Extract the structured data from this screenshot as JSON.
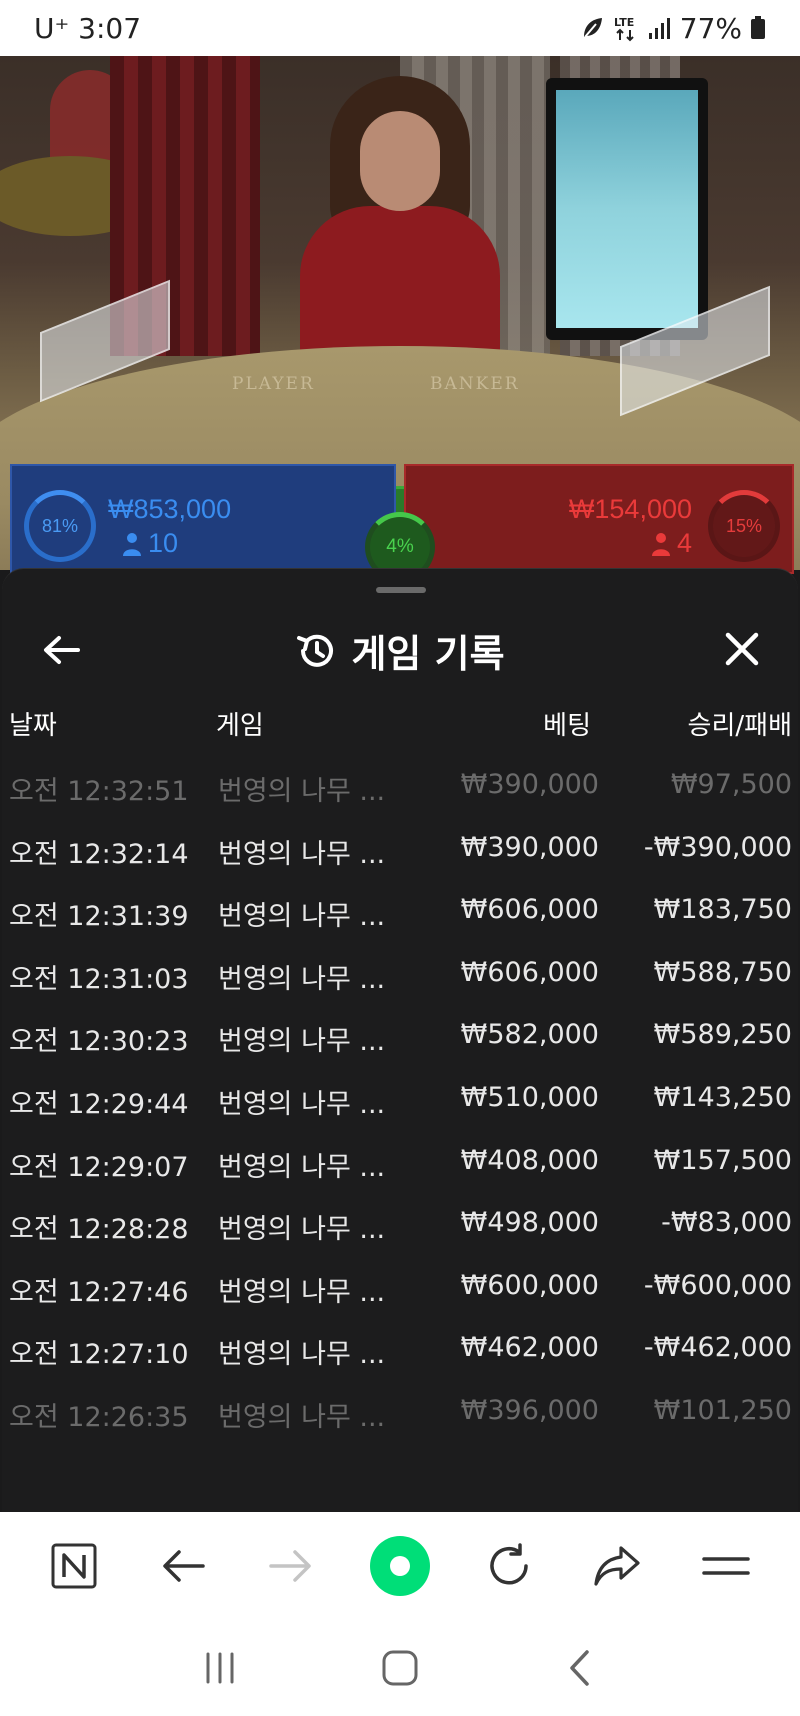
{
  "status_bar": {
    "carrier": "U⁺ 3:07",
    "network": "LTE",
    "battery": "77%"
  },
  "video": {
    "table_labels": {
      "player": "PLAYER",
      "banker": "BANKER"
    }
  },
  "bets": {
    "player": {
      "percent": "81%",
      "amount": "₩853,000",
      "count": "10",
      "color": "#3a8df0"
    },
    "tie": {
      "percent": "4%",
      "color": "#49d24e"
    },
    "banker": {
      "percent": "15%",
      "amount": "₩154,000",
      "count": "4",
      "color": "#ea3a3a"
    }
  },
  "sheet": {
    "title": "게임 기록",
    "icons": {
      "back": "arrow-left-icon",
      "history": "history-icon",
      "close": "close-icon"
    },
    "columns": {
      "date": "날짜",
      "game": "게임",
      "bet": "베팅",
      "result": "승리/패배"
    },
    "rows": [
      {
        "date": "오전 12:32:51",
        "game": "번영의 나무 ...",
        "bet": "₩390,000",
        "result": "₩97,500"
      },
      {
        "date": "오전 12:32:14",
        "game": "번영의 나무 ...",
        "bet": "₩390,000",
        "result": "-₩390,000"
      },
      {
        "date": "오전 12:31:39",
        "game": "번영의 나무 ...",
        "bet": "₩606,000",
        "result": "₩183,750"
      },
      {
        "date": "오전 12:31:03",
        "game": "번영의 나무 ...",
        "bet": "₩606,000",
        "result": "₩588,750"
      },
      {
        "date": "오전 12:30:23",
        "game": "번영의 나무 ...",
        "bet": "₩582,000",
        "result": "₩589,250"
      },
      {
        "date": "오전 12:29:44",
        "game": "번영의 나무 ...",
        "bet": "₩510,000",
        "result": "₩143,250"
      },
      {
        "date": "오전 12:29:07",
        "game": "번영의 나무 ...",
        "bet": "₩408,000",
        "result": "₩157,500"
      },
      {
        "date": "오전 12:28:28",
        "game": "번영의 나무 ...",
        "bet": "₩498,000",
        "result": "-₩83,000"
      },
      {
        "date": "오전 12:27:46",
        "game": "번영의 나무 ...",
        "bet": "₩600,000",
        "result": "-₩600,000"
      },
      {
        "date": "오전 12:27:10",
        "game": "번영의 나무 ...",
        "bet": "₩462,000",
        "result": "-₩462,000"
      },
      {
        "date": "오전 12:26:35",
        "game": "번영의 나무 ...",
        "bet": "₩396,000",
        "result": "₩101,250"
      }
    ]
  },
  "browser_bar": {
    "icons": [
      "naver-home-icon",
      "back-arrow-icon",
      "forward-arrow-icon",
      "green-circle-icon",
      "refresh-icon",
      "share-icon",
      "menu-icon"
    ]
  },
  "nav_bar": {
    "icons": [
      "recent-apps-icon",
      "home-icon",
      "back-icon"
    ]
  }
}
